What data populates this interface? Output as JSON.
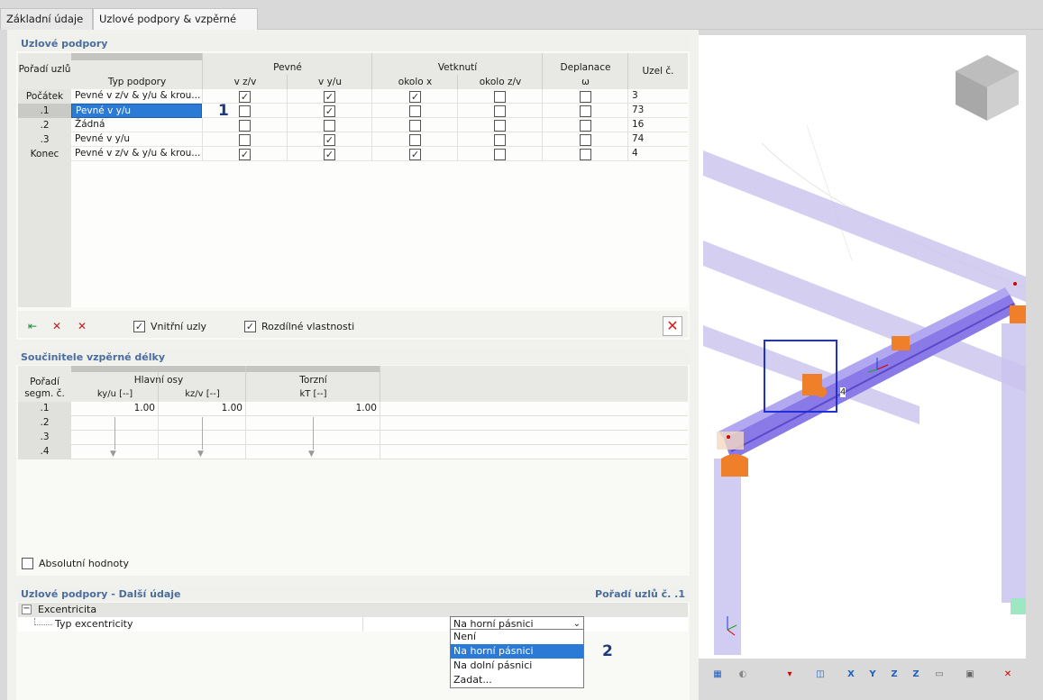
{
  "tabs": [
    "Základní údaje",
    "Uzlové podpory & vzpěrné délky"
  ],
  "nodal_supports": {
    "title": "Uzlové podpory",
    "col_order_header": "Pořadí uzlů",
    "col_type_header": "Typ podpory",
    "group_fixed": "Pevné",
    "group_restraint": "Vetknutí",
    "group_warping": "Deplanace",
    "col_node_header": "Uzel č.",
    "sub_fixed_zv": "v z/v",
    "sub_fixed_yu": "v y/u",
    "sub_rot_x": "okolo x",
    "sub_rot_zv": "okolo z/v",
    "sub_omega": "ω",
    "rows": [
      {
        "order": "Počátek",
        "type": "Pevné v z/v & y/u & krou...",
        "node": "3"
      },
      {
        "order": ".1",
        "type": "Pevné v y/u",
        "node": "73"
      },
      {
        "order": ".2",
        "type": "Žádná",
        "node": "16"
      },
      {
        "order": ".3",
        "type": "Pevné v y/u",
        "node": "74"
      },
      {
        "order": "Konec",
        "type": "Pevné v z/v & y/u & krou...",
        "node": "4"
      }
    ],
    "check_inner_nodes": "Vnitřní uzly",
    "check_diff_props": "Rozdílné vlastnosti"
  },
  "callout_1": "1",
  "callout_2": "2",
  "buckling": {
    "title": "Součinitele vzpěrné délky",
    "col_order": "Pořadí segm. č.",
    "group_main": "Hlavní osy",
    "group_torsion": "Torzní",
    "col_ky": "ky/u [--]",
    "col_kz": "kz/v [--]",
    "col_kt": "kT [--]",
    "rows": [
      {
        "order": ".1",
        "ky": "1.00",
        "kz": "1.00",
        "kt": "1.00"
      },
      {
        "order": ".2",
        "ky": "",
        "kz": "",
        "kt": ""
      },
      {
        "order": ".3",
        "ky": "",
        "kz": "",
        "kt": ""
      },
      {
        "order": ".4",
        "ky": "",
        "kz": "",
        "kt": ""
      }
    ],
    "check_absolute": "Absolutní hodnoty"
  },
  "extra": {
    "title": "Uzlové podpory - Další údaje",
    "right_label": "Pořadí uzlů č. .1",
    "group": "Excentricita",
    "item": "Typ excentricity",
    "selected": "Na horní pásnici",
    "options": [
      "Není",
      "Na horní pásnici",
      "Na dolní pásnici",
      "Zadat..."
    ]
  },
  "view": {
    "node_label": "4"
  }
}
